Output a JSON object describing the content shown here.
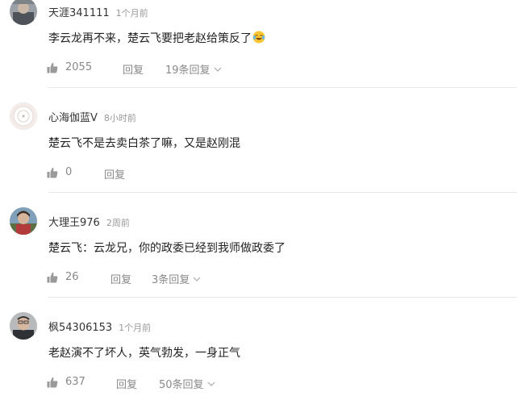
{
  "comments": [
    {
      "username": "天涯341111",
      "time": "1个月前",
      "text": "李云龙再不来，楚云飞要把老赵给策反了",
      "likes": "2055",
      "reply_label": "回复",
      "replies_label": "19条回复"
    },
    {
      "username": "心海伽蓝V",
      "time": "8小时前",
      "text": "楚云飞不是去卖白茶了嘛，又是赵刚混",
      "likes": "0",
      "reply_label": "回复",
      "replies_label": ""
    },
    {
      "username": "大理王976",
      "time": "2周前",
      "text": "楚云飞：云龙兄，你的政委已经到我师做政委了",
      "likes": "26",
      "reply_label": "回复",
      "replies_label": "3条回复"
    },
    {
      "username": "枫54306153",
      "time": "1个月前",
      "text": "老赵演不了坏人，英气勃发，一身正气",
      "likes": "637",
      "reply_label": "回复",
      "replies_label": "50条回复"
    }
  ],
  "icons": {
    "like": "thumbs-up-icon",
    "expand": "chevron-down-icon",
    "emoji": "laughing-crying-emoji-icon"
  },
  "colors": {
    "muted": "#888888",
    "divider": "#e8e8e8",
    "text": "#222222"
  }
}
